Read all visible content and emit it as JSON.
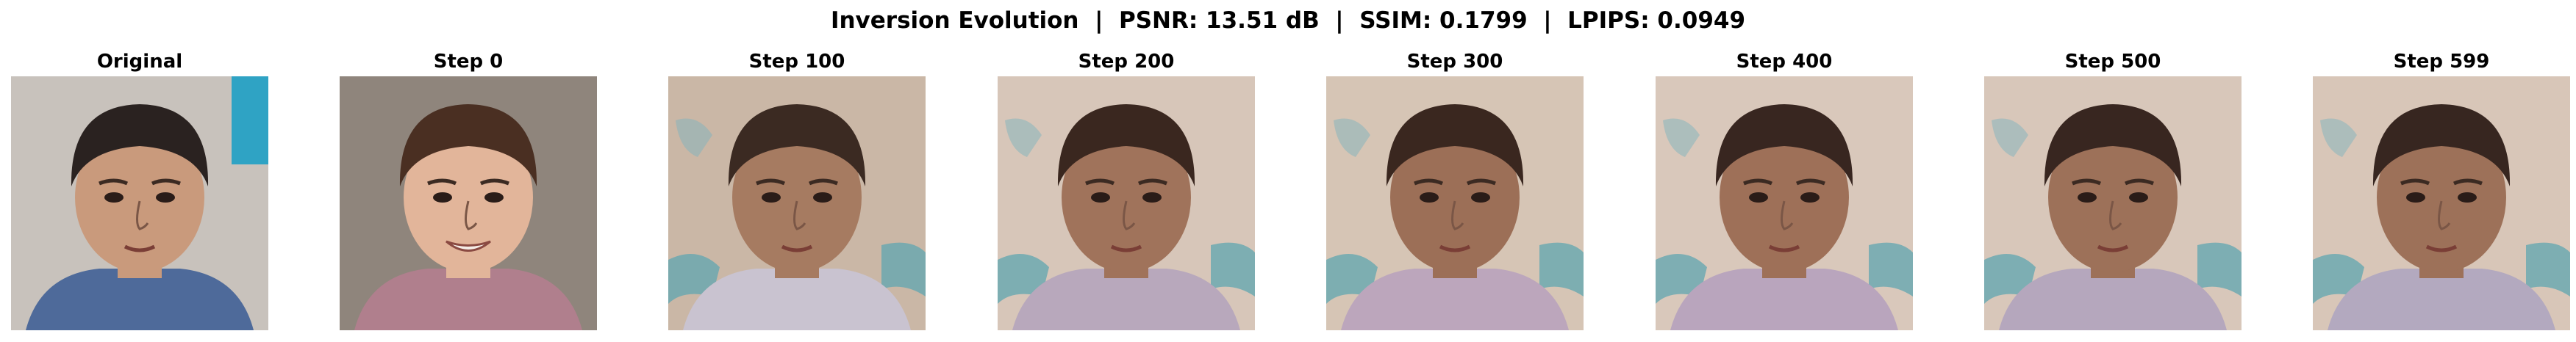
{
  "figure": {
    "title": "Inversion Evolution  |  PSNR: 13.51 dB  |  SSIM: 0.1799  |  LPIPS: 0.0949"
  },
  "panels": [
    {
      "title": "Original",
      "image": "child-face-photo",
      "background": "#c8c2bc",
      "shirt": "#4e6a9a",
      "hair": "#2a2220",
      "skin": "#c99a7c"
    },
    {
      "title": "Step 0",
      "image": "generated-face-step-0",
      "background": "#8f857c",
      "shirt": "#b07f8d",
      "hair": "#4a2f22",
      "skin": "#e2b59a"
    },
    {
      "title": "Step 100",
      "image": "generated-face-step-100",
      "background": "#cab7a6",
      "shirt": "#c9c3d0",
      "hair": "#3b2a22",
      "skin": "#a67b61"
    },
    {
      "title": "Step 200",
      "image": "generated-face-step-200",
      "background": "#d7c6b9",
      "shirt": "#b8a8bc",
      "hair": "#3a271f",
      "skin": "#a0735b"
    },
    {
      "title": "Step 300",
      "image": "generated-face-step-300",
      "background": "#d6c5b5",
      "shirt": "#bca6bc",
      "hair": "#3a271f",
      "skin": "#9c6f57"
    },
    {
      "title": "Step 400",
      "image": "generated-face-step-400",
      "background": "#d9c8bb",
      "shirt": "#b9a5bd",
      "hair": "#382620",
      "skin": "#9e7058"
    },
    {
      "title": "Step 500",
      "image": "generated-face-step-500",
      "background": "#d8c7ba",
      "shirt": "#b5a7bd",
      "hair": "#382620",
      "skin": "#9d7159"
    },
    {
      "title": "Step 599",
      "image": "generated-face-step-599",
      "background": "#d8c6b8",
      "shirt": "#b3a9bf",
      "hair": "#372620",
      "skin": "#9d7159"
    }
  ]
}
